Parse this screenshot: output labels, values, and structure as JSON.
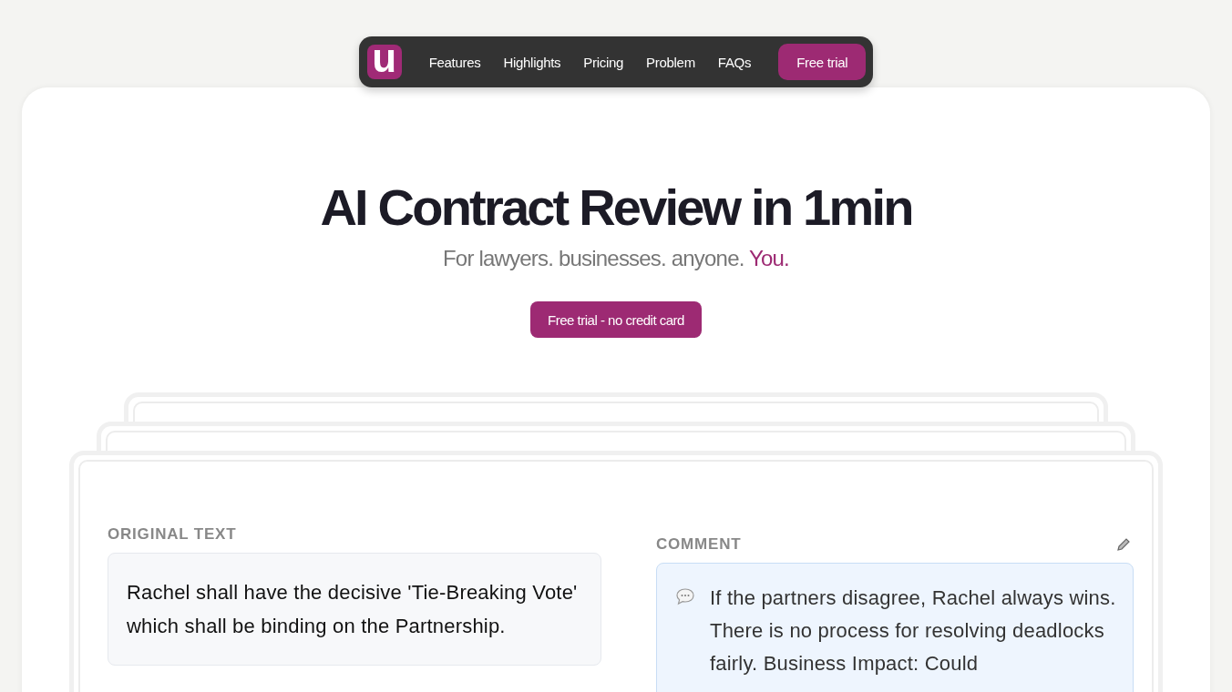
{
  "nav": {
    "logo": "u",
    "links": [
      "Features",
      "Highlights",
      "Pricing",
      "Problem",
      "FAQs"
    ],
    "cta": "Free trial"
  },
  "hero": {
    "title": "AI Contract Review in 1min",
    "subtitle": "For lawyers. businesses. anyone.",
    "subtitle_accent": "You.",
    "cta": "Free trial - no credit card"
  },
  "review": {
    "original_label": "ORIGINAL TEXT",
    "original_text": "Rachel shall have the decisive 'Tie-Breaking Vote' which shall be binding on the Partnership.",
    "comment_label": "COMMENT",
    "comment_text": "If the partners disagree, Rachel always wins. There is no process for resolving deadlocks fairly. Business Impact: Could"
  }
}
